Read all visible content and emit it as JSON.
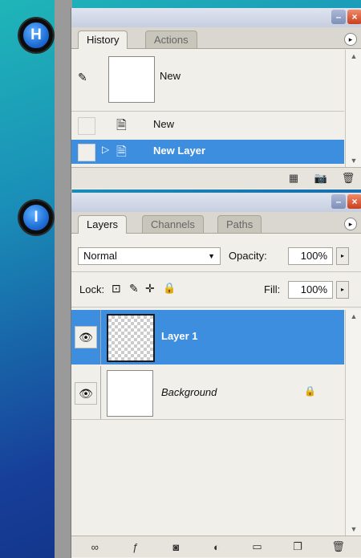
{
  "markers": {
    "h": "H",
    "i": "I"
  },
  "history": {
    "tabs": [
      "History",
      "Actions"
    ],
    "snapshot_label": "New",
    "steps": [
      {
        "label": "New",
        "selected": false
      },
      {
        "label": "New Layer",
        "selected": true
      }
    ]
  },
  "layers": {
    "tabs": [
      "Layers",
      "Channels",
      "Paths"
    ],
    "blend_mode": "Normal",
    "opacity_label": "Opacity:",
    "opacity_value": "100%",
    "lock_label": "Lock:",
    "fill_label": "Fill:",
    "fill_value": "100%",
    "items": [
      {
        "name": "Layer 1",
        "selected": true
      },
      {
        "name": "Background",
        "selected": false,
        "locked": true
      }
    ]
  },
  "colors": {
    "selection": "#3d8ede",
    "marker": "#1f6fd6"
  }
}
